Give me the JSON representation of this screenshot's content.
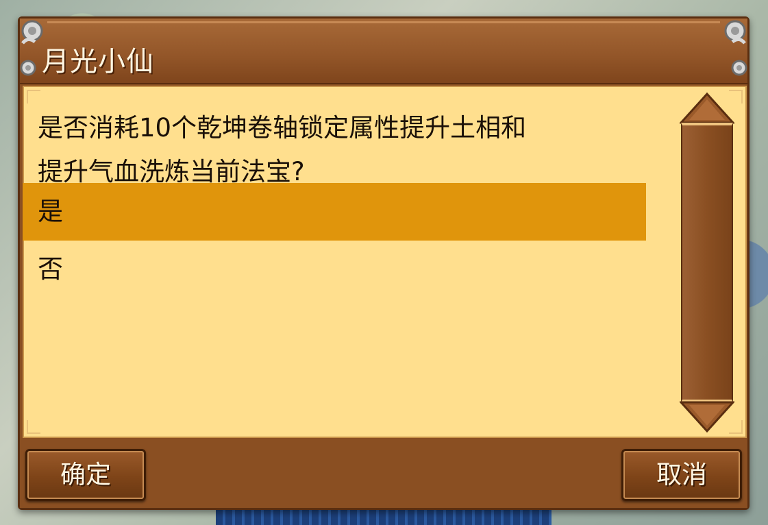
{
  "dialog": {
    "title": "月光小仙",
    "question_line1": "是否消耗10个乾坤卷轴锁定属性提升土相和",
    "question_line2": "提升气血洗炼当前法宝?",
    "options": [
      {
        "label": "是",
        "selected": true
      },
      {
        "label": "否",
        "selected": false
      }
    ],
    "confirm_label": "确定",
    "cancel_label": "取消"
  },
  "colors": {
    "frame": "#8a4f22",
    "panel": "#ffdf8e",
    "selected_option": "#e0950c",
    "button_text": "#fff6e2"
  },
  "icons": {
    "corner": "cloud-scroll-ornament-icon",
    "scroll_up": "triangle-up-icon",
    "scroll_down": "triangle-down-icon"
  }
}
